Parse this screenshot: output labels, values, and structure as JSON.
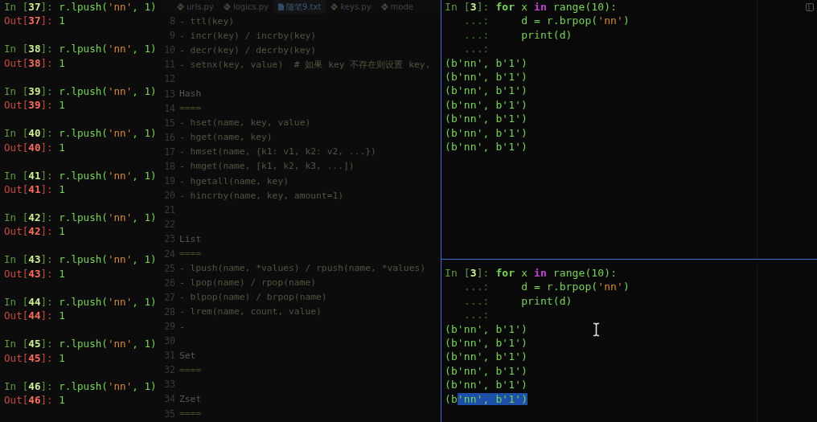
{
  "editor": {
    "tabs": [
      {
        "label": "urls.py",
        "kind": "python",
        "selected": false
      },
      {
        "label": "logics.py",
        "kind": "python",
        "selected": false
      },
      {
        "label": "随笔9.txt",
        "kind": "text",
        "selected": true
      },
      {
        "label": "keys.py",
        "kind": "python",
        "selected": false
      },
      {
        "label": "mode",
        "kind": "python",
        "selected": false
      }
    ],
    "lines": [
      {
        "number": "8",
        "kind": "code",
        "text": "- ttl(key)"
      },
      {
        "number": "9",
        "kind": "code",
        "text": "- incr(key) / incrby(key)"
      },
      {
        "number": "10",
        "kind": "code",
        "text": "- decr(key) / decrby(key)"
      },
      {
        "number": "11",
        "kind": "code",
        "text": "- setnx(key, value)  # 如果 key 不存在则设置 key,"
      },
      {
        "number": "12"
      },
      {
        "number": "13",
        "kind": "heading",
        "text": "Hash"
      },
      {
        "number": "14",
        "kind": "rule",
        "text": "===="
      },
      {
        "number": "15",
        "kind": "code",
        "text": "- hset(name, key, value)"
      },
      {
        "number": "16",
        "kind": "code",
        "text": "- hget(name, key)"
      },
      {
        "number": "17",
        "kind": "code",
        "text": "- hmset(name, {k1: v1, k2: v2, ...})"
      },
      {
        "number": "18",
        "kind": "code",
        "text": "- hmget(name, [k1, k2, k3, ...])"
      },
      {
        "number": "19",
        "kind": "code",
        "text": "- hgetall(name, key)"
      },
      {
        "number": "20",
        "kind": "code",
        "text": "- hincrby(name, key, amount=1)"
      },
      {
        "number": "21"
      },
      {
        "number": "22"
      },
      {
        "number": "23",
        "kind": "heading",
        "text": "List"
      },
      {
        "number": "24",
        "kind": "rule",
        "text": "===="
      },
      {
        "number": "25",
        "kind": "code",
        "text": "- lpush(name, *values) / rpush(name, *values)"
      },
      {
        "number": "26",
        "kind": "code",
        "text": "- lpop(name) / rpop(name)"
      },
      {
        "number": "27",
        "kind": "code",
        "text": "- blpop(name) / brpop(name)"
      },
      {
        "number": "28",
        "kind": "code",
        "text": "- lrem(name, count, value)"
      },
      {
        "number": "29",
        "kind": "code",
        "text": "-"
      },
      {
        "number": "30"
      },
      {
        "number": "31",
        "kind": "heading",
        "text": "Set"
      },
      {
        "number": "32",
        "kind": "rule",
        "text": "===="
      },
      {
        "number": "33"
      },
      {
        "number": "34",
        "kind": "heading",
        "text": "Zset"
      },
      {
        "number": "35",
        "kind": "rule",
        "text": "===="
      }
    ]
  },
  "left_terminal": {
    "entries": [
      {
        "input": [
          {
            "kind": "prompt_in",
            "text": "In ["
          },
          {
            "kind": "in_number",
            "text": "37"
          },
          {
            "kind": "prompt_in",
            "text": "]: "
          },
          {
            "kind": "code",
            "text": "r.lpush("
          },
          {
            "kind": "string",
            "text": "'nn'"
          },
          {
            "kind": "code",
            "text": ", 1)"
          }
        ],
        "output": [
          {
            "kind": "prompt_out",
            "text": "Out["
          },
          {
            "kind": "out_number",
            "text": "37"
          },
          {
            "kind": "prompt_out",
            "text": "]: "
          },
          {
            "kind": "code",
            "text": "1"
          }
        ]
      },
      {
        "input": [
          {
            "kind": "prompt_in",
            "text": "In ["
          },
          {
            "kind": "in_number",
            "text": "38"
          },
          {
            "kind": "prompt_in",
            "text": "]: "
          },
          {
            "kind": "code",
            "text": "r.lpush("
          },
          {
            "kind": "string",
            "text": "'nn'"
          },
          {
            "kind": "code",
            "text": ", 1)"
          }
        ],
        "output": [
          {
            "kind": "prompt_out",
            "text": "Out["
          },
          {
            "kind": "out_number",
            "text": "38"
          },
          {
            "kind": "prompt_out",
            "text": "]: "
          },
          {
            "kind": "code",
            "text": "1"
          }
        ]
      },
      {
        "input": [
          {
            "kind": "prompt_in",
            "text": "In ["
          },
          {
            "kind": "in_number",
            "text": "39"
          },
          {
            "kind": "prompt_in",
            "text": "]: "
          },
          {
            "kind": "code",
            "text": "r.lpush("
          },
          {
            "kind": "string",
            "text": "'nn'"
          },
          {
            "kind": "code",
            "text": ", 1)"
          }
        ],
        "output": [
          {
            "kind": "prompt_out",
            "text": "Out["
          },
          {
            "kind": "out_number",
            "text": "39"
          },
          {
            "kind": "prompt_out",
            "text": "]: "
          },
          {
            "kind": "code",
            "text": "1"
          }
        ]
      },
      {
        "input": [
          {
            "kind": "prompt_in",
            "text": "In ["
          },
          {
            "kind": "in_number",
            "text": "40"
          },
          {
            "kind": "prompt_in",
            "text": "]: "
          },
          {
            "kind": "code",
            "text": "r.lpush("
          },
          {
            "kind": "string",
            "text": "'nn'"
          },
          {
            "kind": "code",
            "text": ", 1)"
          }
        ],
        "output": [
          {
            "kind": "prompt_out",
            "text": "Out["
          },
          {
            "kind": "out_number",
            "text": "40"
          },
          {
            "kind": "prompt_out",
            "text": "]: "
          },
          {
            "kind": "code",
            "text": "1"
          }
        ]
      },
      {
        "input": [
          {
            "kind": "prompt_in",
            "text": "In ["
          },
          {
            "kind": "in_number",
            "text": "41"
          },
          {
            "kind": "prompt_in",
            "text": "]: "
          },
          {
            "kind": "code",
            "text": "r.lpush("
          },
          {
            "kind": "string",
            "text": "'nn'"
          },
          {
            "kind": "code",
            "text": ", 1)"
          }
        ],
        "output": [
          {
            "kind": "prompt_out",
            "text": "Out["
          },
          {
            "kind": "out_number",
            "text": "41"
          },
          {
            "kind": "prompt_out",
            "text": "]: "
          },
          {
            "kind": "code",
            "text": "1"
          }
        ]
      },
      {
        "input": [
          {
            "kind": "prompt_in",
            "text": "In ["
          },
          {
            "kind": "in_number",
            "text": "42"
          },
          {
            "kind": "prompt_in",
            "text": "]: "
          },
          {
            "kind": "code",
            "text": "r.lpush("
          },
          {
            "kind": "string",
            "text": "'nn'"
          },
          {
            "kind": "code",
            "text": ", 1)"
          }
        ],
        "output": [
          {
            "kind": "prompt_out",
            "text": "Out["
          },
          {
            "kind": "out_number",
            "text": "42"
          },
          {
            "kind": "prompt_out",
            "text": "]: "
          },
          {
            "kind": "code",
            "text": "1"
          }
        ]
      },
      {
        "input": [
          {
            "kind": "prompt_in",
            "text": "In ["
          },
          {
            "kind": "in_number",
            "text": "43"
          },
          {
            "kind": "prompt_in",
            "text": "]: "
          },
          {
            "kind": "code",
            "text": "r.lpush("
          },
          {
            "kind": "string",
            "text": "'nn'"
          },
          {
            "kind": "code",
            "text": ", 1)"
          }
        ],
        "output": [
          {
            "kind": "prompt_out",
            "text": "Out["
          },
          {
            "kind": "out_number",
            "text": "43"
          },
          {
            "kind": "prompt_out",
            "text": "]: "
          },
          {
            "kind": "code",
            "text": "1"
          }
        ]
      },
      {
        "input": [
          {
            "kind": "prompt_in",
            "text": "In ["
          },
          {
            "kind": "in_number",
            "text": "44"
          },
          {
            "kind": "prompt_in",
            "text": "]: "
          },
          {
            "kind": "code",
            "text": "r.lpush("
          },
          {
            "kind": "string",
            "text": "'nn'"
          },
          {
            "kind": "code",
            "text": ", 1)"
          }
        ],
        "output": [
          {
            "kind": "prompt_out",
            "text": "Out["
          },
          {
            "kind": "out_number",
            "text": "44"
          },
          {
            "kind": "prompt_out",
            "text": "]: "
          },
          {
            "kind": "code",
            "text": "1"
          }
        ]
      },
      {
        "input": [
          {
            "kind": "prompt_in",
            "text": "In ["
          },
          {
            "kind": "in_number",
            "text": "45"
          },
          {
            "kind": "prompt_in",
            "text": "]: "
          },
          {
            "kind": "code",
            "text": "r.lpush("
          },
          {
            "kind": "string",
            "text": "'nn'"
          },
          {
            "kind": "code",
            "text": ", 1)"
          }
        ],
        "output": [
          {
            "kind": "prompt_out",
            "text": "Out["
          },
          {
            "kind": "out_number",
            "text": "45"
          },
          {
            "kind": "prompt_out",
            "text": "]: "
          },
          {
            "kind": "code",
            "text": "1"
          }
        ]
      },
      {
        "input": [
          {
            "kind": "prompt_in",
            "text": "In ["
          },
          {
            "kind": "in_number",
            "text": "46"
          },
          {
            "kind": "prompt_in",
            "text": "]: "
          },
          {
            "kind": "code",
            "text": "r.lpush("
          },
          {
            "kind": "string",
            "text": "'nn'"
          },
          {
            "kind": "code",
            "text": ", 1)"
          }
        ],
        "output": [
          {
            "kind": "prompt_out",
            "text": "Out["
          },
          {
            "kind": "out_number",
            "text": "46"
          },
          {
            "kind": "prompt_out",
            "text": "]: "
          },
          {
            "kind": "code",
            "text": "1"
          }
        ]
      }
    ]
  },
  "right_terminals": [
    {
      "input_lines": [
        [
          {
            "kind": "prompt_in",
            "text": "In ["
          },
          {
            "kind": "in_number",
            "text": "3"
          },
          {
            "kind": "prompt_in",
            "text": "]: "
          },
          {
            "kind": "keyword",
            "text": "for"
          },
          {
            "kind": "code",
            "text": " x "
          },
          {
            "kind": "keyword_in",
            "text": "in"
          },
          {
            "kind": "code",
            "text": " range(10):"
          }
        ],
        [
          {
            "kind": "continuation",
            "text": "   ...:     "
          },
          {
            "kind": "code",
            "text": "d = r.brpop("
          },
          {
            "kind": "string",
            "text": "'nn'"
          },
          {
            "kind": "code",
            "text": ")"
          }
        ],
        [
          {
            "kind": "continuation",
            "text": "   ...:     "
          },
          {
            "kind": "code",
            "text": "print(d)"
          }
        ],
        [
          {
            "kind": "continuation",
            "text": "   ...:"
          }
        ]
      ],
      "outputs": [
        [
          {
            "text": "(b'nn', b'1')",
            "selected": false
          }
        ],
        [
          {
            "text": "(b'nn', b'1')",
            "selected": false
          }
        ],
        [
          {
            "text": "(b'nn', b'1')",
            "selected": false
          }
        ],
        [
          {
            "text": "(b'nn', b'1')",
            "selected": false
          }
        ],
        [
          {
            "text": "(b'nn', b'1')",
            "selected": false
          }
        ],
        [
          {
            "text": "(b'nn', b'1')",
            "selected": false
          }
        ],
        [
          {
            "text": "(b'nn', b'1')",
            "selected": false
          }
        ]
      ]
    },
    {
      "input_lines": [
        [
          {
            "kind": "prompt_in",
            "text": "In ["
          },
          {
            "kind": "in_number",
            "text": "3"
          },
          {
            "kind": "prompt_in",
            "text": "]: "
          },
          {
            "kind": "keyword",
            "text": "for"
          },
          {
            "kind": "code",
            "text": " x "
          },
          {
            "kind": "keyword_in",
            "text": "in"
          },
          {
            "kind": "code",
            "text": " range(10):"
          }
        ],
        [
          {
            "kind": "continuation",
            "text": "   ...:     "
          },
          {
            "kind": "code",
            "text": "d = r.brpop("
          },
          {
            "kind": "string",
            "text": "'nn'"
          },
          {
            "kind": "code",
            "text": ")"
          }
        ],
        [
          {
            "kind": "continuation",
            "text": "   ...:     "
          },
          {
            "kind": "code",
            "text": "print(d)"
          }
        ],
        [
          {
            "kind": "continuation",
            "text": "   ...:"
          }
        ]
      ],
      "outputs": [
        [
          {
            "text": "(b'nn', b'1')",
            "selected": false
          }
        ],
        [
          {
            "text": "(b'nn', b'1')",
            "selected": false
          }
        ],
        [
          {
            "text": "(b'nn', b'1')",
            "selected": false
          }
        ],
        [
          {
            "text": "(b'nn', b'1')",
            "selected": false
          }
        ],
        [
          {
            "text": "(b'nn', b'1')",
            "selected": false
          }
        ],
        [
          {
            "text": "(b",
            "selected": false
          },
          {
            "text": "'nn', b'1')",
            "selected": true
          }
        ]
      ],
      "text_cursor": true
    }
  ]
}
